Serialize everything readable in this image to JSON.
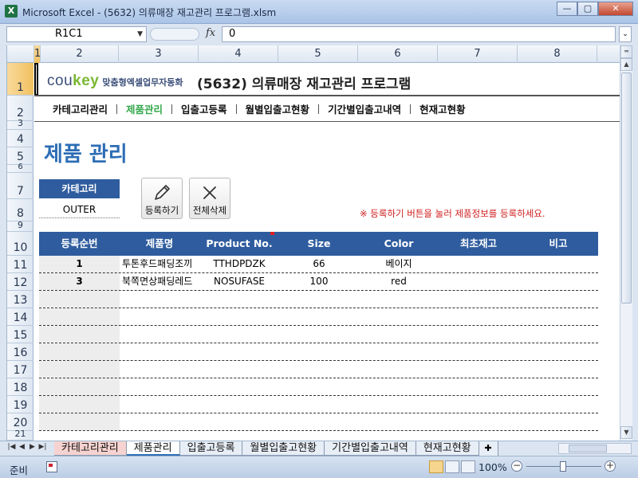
{
  "window": {
    "title": "Microsoft Excel - (5632) 의류매장 재고관리 프로그램.xlsm",
    "app_icon": "excel-icon",
    "minimize": "—",
    "maximize": "▢",
    "close": "✕"
  },
  "formula_bar": {
    "name_box": "R1C1",
    "fx": "fx",
    "value": "0"
  },
  "columns": [
    "1",
    "2",
    "3",
    "4",
    "5",
    "6",
    "7",
    "8"
  ],
  "rows": [
    "1",
    "2",
    "3",
    "4",
    "5",
    "6",
    "7",
    "8",
    "9",
    "10",
    "11",
    "12",
    "13",
    "14",
    "15",
    "16",
    "17",
    "18",
    "19",
    "20",
    "21"
  ],
  "header": {
    "logo_main": "cou",
    "logo_accent": "key",
    "logo_sub": "맞춤형엑셀업무자동화",
    "app_title": "(5632) 의류매장 재고관리 프로그램"
  },
  "nav": {
    "items": [
      {
        "label": "카테고리관리",
        "active": false
      },
      {
        "label": "제품관리",
        "active": true
      },
      {
        "label": "입출고등록",
        "active": false
      },
      {
        "label": "월별입출고현황",
        "active": false
      },
      {
        "label": "기간별입출고내역",
        "active": false
      },
      {
        "label": "현재고현황",
        "active": false
      }
    ],
    "active_color": "#32a84a"
  },
  "page": {
    "title": "제품 관리",
    "category_label": "카테고리",
    "category_value": "OUTER",
    "register_button": "등록하기",
    "delete_all_button": "전체삭제",
    "notice": "※ 등록하기 버튼을 눌러 제품정보를 등록하세요."
  },
  "table": {
    "headers": [
      "등록순번",
      "제품명",
      "Product No.",
      "Size",
      "Color",
      "최초재고",
      "비고"
    ],
    "rows": [
      [
        "1",
        "투톤후드패딩조끼",
        "TTHDPDZK",
        "66",
        "베이지",
        "",
        ""
      ],
      [
        "3",
        "북쪽면상패딩레드",
        "NOSUFASE",
        "100",
        "red",
        "",
        ""
      ]
    ],
    "empty_row_count": 8,
    "header_color": "#2f5c9e"
  },
  "sheet_tabs": [
    {
      "label": "카테고리관리",
      "active": false
    },
    {
      "label": "제품관리",
      "active": true
    },
    {
      "label": "입출고등록",
      "active": false
    },
    {
      "label": "월별입출고현황",
      "active": false
    },
    {
      "label": "기간별입출고내역",
      "active": false
    },
    {
      "label": "현재고현황",
      "active": false
    }
  ],
  "status": {
    "text": "준비",
    "zoom": "100%"
  }
}
